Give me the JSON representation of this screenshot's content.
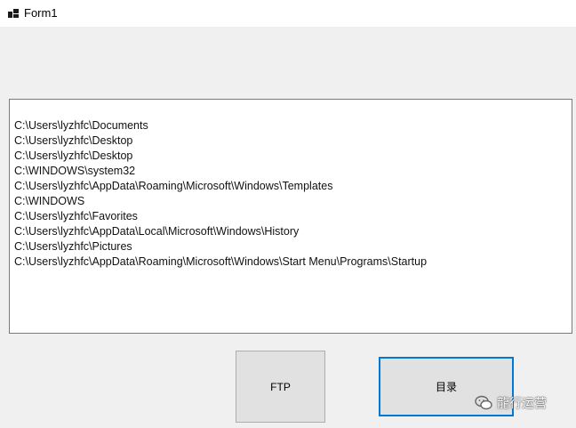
{
  "window": {
    "title": "Form1"
  },
  "textbox": {
    "lines": [
      "C:\\Users\\lyzhfc\\Documents",
      "C:\\Users\\lyzhfc\\Desktop",
      "C:\\Users\\lyzhfc\\Desktop",
      "C:\\WINDOWS\\system32",
      "C:\\Users\\lyzhfc\\AppData\\Roaming\\Microsoft\\Windows\\Templates",
      "C:\\WINDOWS",
      "C:\\Users\\lyzhfc\\Favorites",
      "C:\\Users\\lyzhfc\\AppData\\Local\\Microsoft\\Windows\\History",
      "C:\\Users\\lyzhfc\\Pictures",
      "C:\\Users\\lyzhfc\\AppData\\Roaming\\Microsoft\\Windows\\Start Menu\\Programs\\Startup"
    ]
  },
  "buttons": {
    "ftp_label": "FTP",
    "directory_label": "目录"
  },
  "watermark": {
    "text": "龍行运营",
    "icon": "wechat-icon"
  },
  "colors": {
    "focus_border": "#0078d7",
    "button_face": "#e1e1e1",
    "form_background": "#f0f0f0"
  }
}
